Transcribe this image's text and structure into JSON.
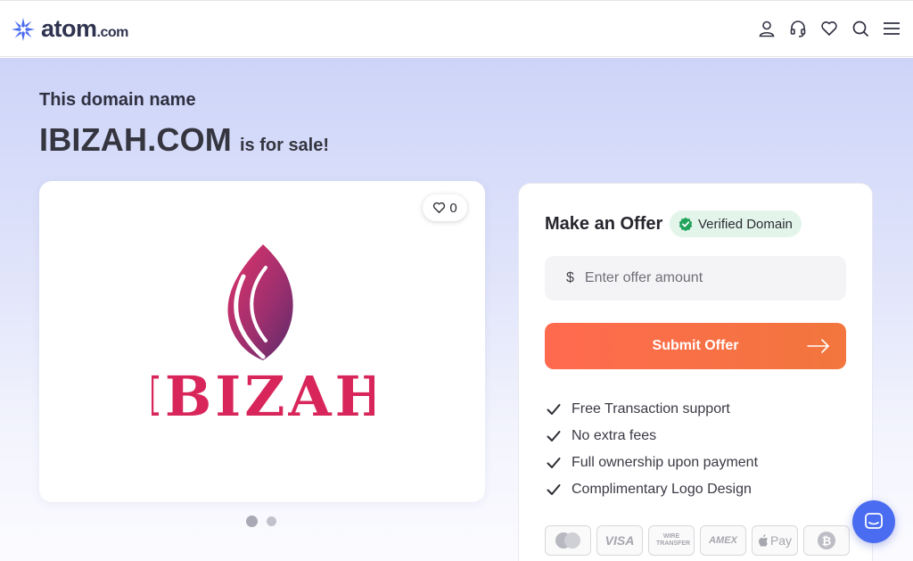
{
  "header": {
    "logo_word": "atom",
    "logo_tld": ".com",
    "icons": [
      "user-icon",
      "headset-icon",
      "heart-icon",
      "search-icon",
      "menu-icon"
    ]
  },
  "hero": {
    "eyebrow": "This domain name",
    "domain": "IBIZAH.COM",
    "for_sale": "is for sale!"
  },
  "gallery": {
    "likes": "0",
    "logo_text": "IBIZAH",
    "slides": 2,
    "active_slide": 1
  },
  "offer": {
    "title": "Make an Offer",
    "verified_label": "Verified Domain",
    "currency_symbol": "$",
    "input_placeholder": "Enter offer amount",
    "input_value": "",
    "submit_label": "Submit Offer",
    "features": [
      "Free Transaction support",
      "No extra fees",
      "Full ownership upon payment",
      "Complimentary Logo Design"
    ],
    "payment_methods": [
      "mastercard",
      "VISA",
      "WIRE TRANSFER",
      "AMEX",
      "Pay",
      "bitcoin"
    ]
  },
  "colors": {
    "accent": "#ff6a4f",
    "brand": "#4a6cf0",
    "verified": "#22a35a",
    "logo_pink": "#d8265a"
  }
}
